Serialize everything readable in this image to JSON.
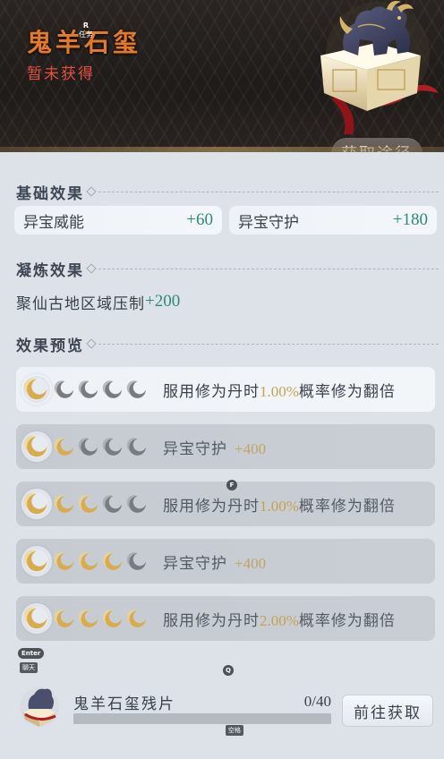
{
  "header": {
    "title": "鬼羊石玺",
    "status": "暂未获得",
    "obtain_button": "获取途径"
  },
  "base_effects": {
    "heading": "基础效果",
    "stats": [
      {
        "label": "异宝威能",
        "value": "+60"
      },
      {
        "label": "异宝守护",
        "value": "+180"
      }
    ]
  },
  "refine_effects": {
    "heading": "凝炼效果",
    "line_label": "聚仙古地区域压制",
    "line_value": "+200"
  },
  "preview": {
    "heading": "效果预览",
    "rows": [
      {
        "filled": 1,
        "pre": "服用修为丹时",
        "highlight": "1.00%",
        "post": "概率修为翻倍",
        "active": true
      },
      {
        "filled": 2,
        "pre": "异宝守护",
        "highlight": "+400",
        "post": "",
        "active": false
      },
      {
        "filled": 3,
        "pre": "服用修为丹时",
        "highlight": "1.00%",
        "post": "概率修为翻倍",
        "active": false
      },
      {
        "filled": 4,
        "pre": "异宝守护",
        "highlight": "+400",
        "post": "",
        "active": false
      },
      {
        "filled": 5,
        "pre": "服用修为丹时",
        "highlight": "2.00%",
        "post": "概率修为翻倍",
        "active": false
      }
    ]
  },
  "fragment": {
    "name": "鬼羊石玺残片",
    "count": "0/40",
    "progress": 0,
    "goto_button": "前往获取"
  },
  "key_hints": {
    "r_key": "R",
    "r_label": "任务",
    "f_key": "F",
    "enter_key": "Enter",
    "enter_label": "聊天",
    "q_key": "Q",
    "space_label": "空格"
  },
  "colors": {
    "title": "#e07a2c",
    "status": "#e4503f",
    "stat_value": "#2d8a79",
    "highlight": "#c9a050"
  }
}
